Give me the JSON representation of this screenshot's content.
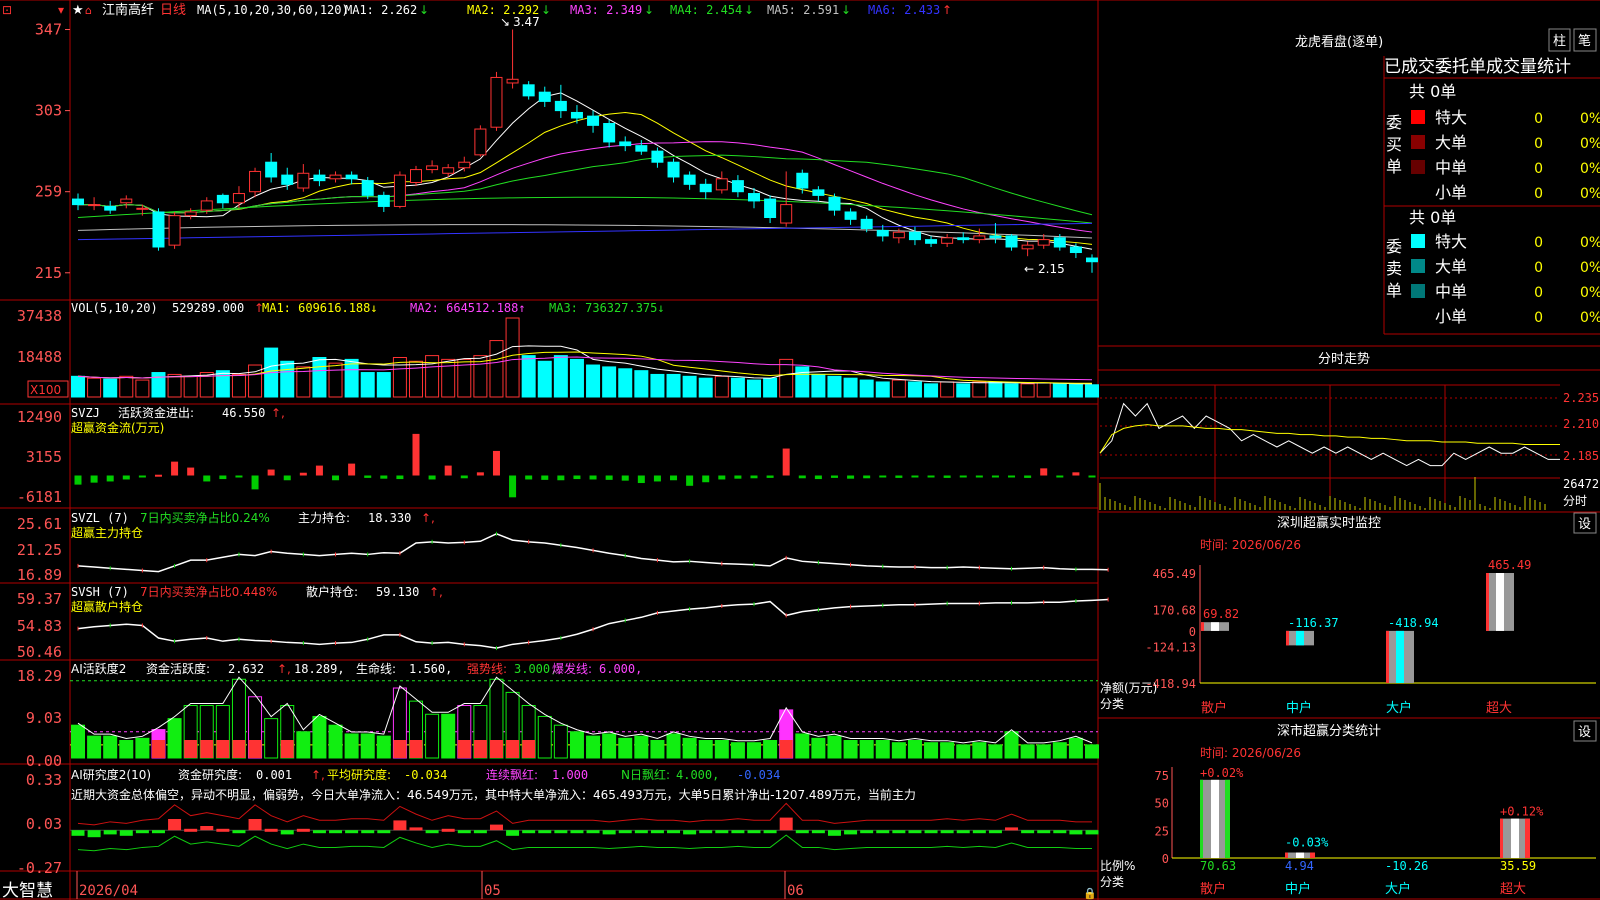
{
  "colors": {
    "up": "#ff3333",
    "down": "#00ffff",
    "grid": "#b00000",
    "ma1": "#ffffff",
    "ma2": "#ffff00",
    "ma3": "#ff44ff",
    "ma4": "#22dd22",
    "ma5": "#c0c0c0",
    "ma6": "#3333ff",
    "label": "#ff4444",
    "axis": "#ff5555"
  },
  "stock": {
    "name": "江南高纤",
    "period": "日线",
    "ma_label": "MA(5,10,20,30,60,120)"
  },
  "main_pane": {
    "ma_values": [
      {
        "name": "MA1",
        "value": "2.262",
        "arrow": "↓"
      },
      {
        "name": "MA2",
        "value": "2.292",
        "arrow": "↓"
      },
      {
        "name": "MA3",
        "value": "2.349",
        "arrow": "↓"
      },
      {
        "name": "MA4",
        "value": "2.454",
        "arrow": "↓"
      },
      {
        "name": "MA5",
        "value": "2.591",
        "arrow": "↓"
      },
      {
        "name": "MA6",
        "value": "2.433",
        "arrow": "↑"
      }
    ],
    "y_ticks": [
      "3.47",
      "3.03",
      "2.59",
      "2.15"
    ],
    "high_mark": "3.47",
    "low_mark": "2.15"
  },
  "vol_pane": {
    "title": "VOL(5,10,20)",
    "value": "529289.000",
    "ma1": "609616.188",
    "ma2": "664512.188",
    "ma3": "736327.375",
    "y_ticks": [
      "37438",
      "18488"
    ],
    "unit": "X100"
  },
  "svzj_pane": {
    "title": "SVZJ",
    "label": "活跃资金进出:",
    "value": "46.550",
    "sub": "超赢资金流(万元)",
    "y_ticks": [
      "12490",
      "3155",
      "-6181"
    ]
  },
  "svzl_pane": {
    "title": "SVZL (7)",
    "label1": "7日内买卖净占比0.24%",
    "label2": "主力持仓:",
    "value": "18.330",
    "sub": "超赢主力持仓",
    "y_ticks": [
      "25.61",
      "21.25",
      "16.89"
    ]
  },
  "svsh_pane": {
    "title": "SVSH (7)",
    "label1": "7日内买卖净占比0.448%",
    "label2": "散户持仓:",
    "value": "59.130",
    "sub": "超赢散户持仓",
    "y_ticks": [
      "59.37",
      "54.83",
      "50.46"
    ]
  },
  "ai_pane": {
    "title": "AI活跃度2",
    "l1": "资金活跃度:",
    "v1": "2.632",
    "v2": "18.289,",
    "l3": "生命线:",
    "v3": "1.560,",
    "l4": "强势线:",
    "v4": "3.000,",
    "l5": "爆发线:",
    "v5": "6.000,",
    "y_ticks": [
      "18.29",
      "9.03",
      "0.00"
    ]
  },
  "ai2_pane": {
    "title": "AI研究度2(10)",
    "l1": "资金研究度:",
    "v1": "0.001",
    "l2": "平均研究度:",
    "v2": "-0.034",
    "l3": "连续飘红:",
    "v3": "1.000",
    "l4": "N日飘红:",
    "v4": "4.000,",
    "v5": "-0.034",
    "desc": "近期大资金总体偏空，异动不明显，偏弱势，今日大单净流入：46.549万元，其中特大单净流入：465.493万元，大单5日累计净出-1207.489万元，当前主力",
    "y_ticks": [
      "0.33",
      "0.03",
      "-0.27"
    ]
  },
  "bottom": {
    "brand": "大智慧",
    "dates": [
      "2026/04",
      "05",
      "06"
    ]
  },
  "lhb": {
    "title": "龙虎看盘(逐单)",
    "btn1": "柱",
    "btn2": "笔",
    "header": "已成交委托单成交量统计",
    "buy_side": "委买单",
    "sell_side": "委卖单",
    "buy_total": "共 0单",
    "sell_total": "共 0单",
    "buy_rows": [
      {
        "label": "特大",
        "qty": "0",
        "pct": "0%"
      },
      {
        "label": "大单",
        "qty": "0",
        "pct": "0%"
      },
      {
        "label": "中单",
        "qty": "0",
        "pct": "0%"
      },
      {
        "label": "小单",
        "qty": "0",
        "pct": "0%"
      }
    ],
    "sell_rows": [
      {
        "label": "特大",
        "qty": "0",
        "pct": "0%"
      },
      {
        "label": "大单",
        "qty": "0",
        "pct": "0%"
      },
      {
        "label": "中单",
        "qty": "0",
        "pct": "0%"
      },
      {
        "label": "小单",
        "qty": "0",
        "pct": "0%"
      }
    ]
  },
  "intraday": {
    "title": "分时走势",
    "y_ticks": [
      "2.235",
      "2.210",
      "2.185"
    ],
    "vol_label": "26472",
    "tab": "分时"
  },
  "monitor": {
    "title": "深圳超赢实时监控",
    "btn": "设",
    "time": "时间: 2026/06/26",
    "y_ticks": [
      "465.49",
      "170.68",
      "0",
      "-124.13",
      "-418.94"
    ],
    "ylabel": "净额(万元)",
    "xlabel": "分类",
    "categories": [
      "散户",
      "中户",
      "大户",
      "超大"
    ]
  },
  "classify": {
    "title": "深市超赢分类统计",
    "btn": "设",
    "time": "时间: 2026/06/26",
    "y_ticks": [
      "75",
      "50",
      "25",
      "0"
    ],
    "ylabel": "比例%",
    "xlabel": "分类",
    "categories": [
      "散户",
      "中户",
      "大户",
      "超大"
    ]
  },
  "chart_data": [
    {
      "type": "candlestick",
      "title": "江南高纤 日线",
      "ma_periods": [
        5,
        10,
        20,
        30,
        60,
        120
      ],
      "ylim": [
        2.1,
        3.5
      ],
      "candles": [
        [
          2.55,
          2.52,
          2.58,
          2.49
        ],
        [
          2.52,
          2.52,
          2.56,
          2.49
        ],
        [
          2.51,
          2.49,
          2.54,
          2.47
        ],
        [
          2.53,
          2.55,
          2.57,
          2.5
        ],
        [
          2.5,
          2.5,
          2.52,
          2.46
        ],
        [
          2.48,
          2.29,
          2.5,
          2.27
        ],
        [
          2.3,
          2.46,
          2.48,
          2.28
        ],
        [
          2.46,
          2.48,
          2.5,
          2.44
        ],
        [
          2.49,
          2.54,
          2.56,
          2.47
        ],
        [
          2.57,
          2.53,
          2.58,
          2.5
        ],
        [
          2.53,
          2.58,
          2.62,
          2.5
        ],
        [
          2.59,
          2.7,
          2.72,
          2.56
        ],
        [
          2.75,
          2.67,
          2.8,
          2.64
        ],
        [
          2.68,
          2.63,
          2.72,
          2.6
        ],
        [
          2.61,
          2.69,
          2.74,
          2.59
        ],
        [
          2.68,
          2.65,
          2.71,
          2.62
        ],
        [
          2.66,
          2.68,
          2.7,
          2.64
        ],
        [
          2.68,
          2.66,
          2.7,
          2.63
        ],
        [
          2.65,
          2.57,
          2.67,
          2.55
        ],
        [
          2.57,
          2.51,
          2.59,
          2.48
        ],
        [
          2.51,
          2.68,
          2.7,
          2.5
        ],
        [
          2.64,
          2.71,
          2.73,
          2.62
        ],
        [
          2.71,
          2.73,
          2.76,
          2.69
        ],
        [
          2.69,
          2.72,
          2.74,
          2.67
        ],
        [
          2.72,
          2.75,
          2.78,
          2.7
        ],
        [
          2.79,
          2.93,
          2.95,
          2.78
        ],
        [
          2.94,
          3.21,
          3.24,
          2.92
        ],
        [
          3.18,
          3.2,
          3.47,
          3.15
        ],
        [
          3.17,
          3.11,
          3.19,
          3.09
        ],
        [
          3.13,
          3.08,
          3.16,
          3.05
        ],
        [
          3.08,
          3.03,
          3.17,
          2.99
        ],
        [
          3.02,
          2.99,
          3.06,
          2.96
        ],
        [
          3.0,
          2.95,
          3.03,
          2.91
        ],
        [
          2.96,
          2.86,
          2.98,
          2.83
        ],
        [
          2.86,
          2.84,
          2.89,
          2.81
        ],
        [
          2.84,
          2.81,
          2.87,
          2.79
        ],
        [
          2.81,
          2.75,
          2.83,
          2.72
        ],
        [
          2.75,
          2.67,
          2.77,
          2.64
        ],
        [
          2.68,
          2.63,
          2.7,
          2.6
        ],
        [
          2.63,
          2.59,
          2.66,
          2.55
        ],
        [
          2.6,
          2.66,
          2.7,
          2.58
        ],
        [
          2.65,
          2.59,
          2.68,
          2.56
        ],
        [
          2.58,
          2.54,
          2.61,
          2.5
        ],
        [
          2.55,
          2.45,
          2.57,
          2.42
        ],
        [
          2.42,
          2.52,
          2.7,
          2.4
        ],
        [
          2.69,
          2.61,
          2.71,
          2.58
        ],
        [
          2.6,
          2.57,
          2.62,
          2.54
        ],
        [
          2.56,
          2.49,
          2.58,
          2.46
        ],
        [
          2.48,
          2.44,
          2.5,
          2.41
        ],
        [
          2.44,
          2.39,
          2.46,
          2.37
        ],
        [
          2.38,
          2.35,
          2.41,
          2.32
        ],
        [
          2.34,
          2.37,
          2.39,
          2.31
        ],
        [
          2.37,
          2.33,
          2.4,
          2.3
        ],
        [
          2.33,
          2.31,
          2.35,
          2.29
        ],
        [
          2.31,
          2.34,
          2.36,
          2.29
        ],
        [
          2.34,
          2.33,
          2.37,
          2.31
        ],
        [
          2.33,
          2.35,
          2.39,
          2.31
        ],
        [
          2.35,
          2.34,
          2.42,
          2.31
        ],
        [
          2.35,
          2.29,
          2.36,
          2.27
        ],
        [
          2.28,
          2.3,
          2.32,
          2.24
        ],
        [
          2.3,
          2.33,
          2.36,
          2.28
        ],
        [
          2.34,
          2.29,
          2.36,
          2.27
        ],
        [
          2.29,
          2.26,
          2.31,
          2.23
        ],
        [
          2.23,
          2.21,
          2.25,
          2.15
        ]
      ],
      "ma_values": {
        "MA1": 2.262,
        "MA2": 2.292,
        "MA3": 2.349,
        "MA4": 2.454,
        "MA5": 2.591,
        "MA6": 2.433
      }
    },
    {
      "type": "bar",
      "title": "VOL(5,10,20)",
      "unit": "X100",
      "ylim": [
        0,
        42000
      ],
      "values": [
        11000,
        10000,
        9500,
        11000,
        9000,
        13000,
        12000,
        11000,
        13000,
        14000,
        12000,
        17000,
        26000,
        19000,
        16000,
        21000,
        18000,
        20000,
        13000,
        13000,
        21000,
        19000,
        22000,
        20000,
        20000,
        22000,
        30000,
        42000,
        22000,
        19000,
        22000,
        20000,
        17000,
        16000,
        15000,
        14000,
        12000,
        12000,
        11000,
        10000,
        11000,
        10000,
        9000,
        10000,
        20000,
        16000,
        12000,
        11000,
        10000,
        9000,
        8000,
        9000,
        8000,
        7000,
        8000,
        7000,
        8000,
        8000,
        7000,
        7000,
        7500,
        7000,
        6800,
        6500
      ]
    },
    {
      "type": "bar",
      "title": "SVZJ 超赢资金流(万元)",
      "ylim": [
        -6181,
        12490
      ],
      "values": [
        -2300,
        -1800,
        -1500,
        -1000,
        -500,
        200,
        3500,
        2000,
        -1500,
        -900,
        -400,
        -3500,
        1500,
        -1200,
        700,
        2500,
        -1200,
        3000,
        -600,
        -800,
        -900,
        10500,
        -1000,
        2500,
        -700,
        800,
        6200,
        -5500,
        -1000,
        -1100,
        -1200,
        -900,
        -1000,
        -1100,
        -1300,
        -1900,
        -1500,
        -1200,
        -2600,
        -1700,
        -1000,
        -800,
        -700,
        -600,
        6800,
        -700,
        -900,
        -600,
        -800,
        -700,
        -500,
        -600,
        -400,
        -500,
        -600,
        -500,
        -400,
        -500,
        -300,
        -600,
        1800,
        -500,
        800,
        -500,
        -800
      ]
    },
    {
      "type": "line",
      "title": "SVZL 超赢主力持仓",
      "ylim": [
        16.89,
        25.61
      ],
      "values": [
        19.0,
        18.8,
        18.6,
        18.4,
        18.2,
        18.0,
        19.0,
        20.0,
        20.0,
        20.5,
        21.0,
        20.8,
        21.5,
        21.2,
        21.0,
        20.8,
        21.0,
        21.2,
        21.0,
        21.3,
        21.2,
        23.0,
        23.2,
        23.0,
        23.1,
        23.3,
        24.6,
        23.5,
        23.2,
        23.0,
        22.6,
        22.2,
        21.7,
        21.2,
        20.8,
        20.3,
        20.0,
        19.7,
        19.8,
        19.6,
        19.4,
        19.3,
        19.2,
        19.0,
        20.4,
        19.8,
        19.6,
        19.4,
        19.2,
        19.0,
        18.9,
        18.8,
        18.8,
        18.7,
        18.7,
        18.8,
        18.7,
        18.6,
        18.5,
        18.6,
        18.7,
        18.5,
        18.4,
        18.4,
        18.33
      ]
    },
    {
      "type": "line",
      "title": "SVSH 超赢散户持仓",
      "ylim": [
        50.46,
        59.37
      ],
      "values": [
        54.5,
        54.8,
        55.0,
        55.2,
        55.0,
        53.0,
        52.5,
        52.8,
        53.0,
        52.5,
        52.8,
        52.6,
        52.5,
        52.3,
        52.2,
        52.0,
        52.2,
        52.3,
        52.8,
        53.5,
        53.5,
        52.4,
        52.2,
        52.3,
        52.0,
        51.8,
        51.4,
        52.0,
        52.3,
        52.6,
        53.0,
        53.6,
        54.4,
        55.3,
        55.8,
        56.3,
        57.0,
        57.3,
        57.6,
        57.8,
        58.1,
        58.3,
        58.4,
        58.8,
        56.6,
        57.2,
        57.5,
        57.8,
        58.0,
        58.1,
        58.2,
        58.3,
        58.3,
        58.4,
        58.5,
        58.5,
        58.5,
        58.6,
        58.6,
        58.6,
        58.7,
        58.7,
        58.9,
        59.0,
        59.13
      ]
    },
    {
      "type": "bar",
      "title": "AI活跃度2",
      "ylim": [
        0,
        18.29
      ],
      "reference_lines": [
        1.56,
        3.0,
        6.0
      ],
      "values": [
        7.5,
        5.0,
        5.0,
        4.0,
        4.5,
        6.5,
        9.0,
        12.0,
        12.0,
        12.0,
        18.0,
        14.0,
        9.0,
        12.0,
        6.0,
        9.5,
        7.5,
        5.5,
        5.5,
        5.0,
        16.0,
        13.0,
        10.0,
        10.0,
        12.0,
        12.0,
        18.0,
        15.0,
        12.0,
        9.5,
        7.5,
        6.0,
        5.0,
        5.5,
        4.5,
        5.0,
        4.0,
        5.5,
        4.5,
        4.0,
        4.0,
        3.5,
        3.5,
        4.0,
        11.0,
        5.5,
        4.5,
        5.0,
        4.0,
        4.0,
        4.0,
        3.5,
        4.0,
        3.5,
        3.5,
        3.0,
        3.5,
        3.0,
        6.0,
        3.0,
        3.0,
        3.5,
        4.5,
        3.0,
        2.6
      ]
    },
    {
      "type": "bar",
      "title": "AI研究度2(10)",
      "ylim": [
        -0.27,
        0.33
      ],
      "values": [
        -0.04,
        -0.05,
        -0.03,
        -0.04,
        -0.02,
        -0.01,
        0.08,
        0.01,
        0.03,
        0.01,
        -0.01,
        0.08,
        0.01,
        -0.03,
        0.01,
        -0.02,
        -0.02,
        -0.01,
        -0.01,
        -0.02,
        0.07,
        0.02,
        -0.02,
        0.01,
        -0.01,
        -0.01,
        0.04,
        -0.04,
        -0.02,
        -0.02,
        -0.02,
        -0.02,
        -0.02,
        -0.03,
        -0.02,
        -0.01,
        -0.02,
        -0.02,
        -0.03,
        -0.02,
        -0.02,
        -0.01,
        -0.02,
        -0.02,
        0.09,
        -0.02,
        -0.02,
        -0.04,
        -0.03,
        -0.02,
        -0.02,
        -0.02,
        -0.02,
        -0.02,
        -0.01,
        -0.02,
        -0.01,
        -0.02,
        0.02,
        -0.02,
        -0.02,
        -0.02,
        -0.03,
        -0.03,
        0.001
      ]
    },
    {
      "type": "line",
      "title": "分时走势",
      "ylim": [
        2.17,
        2.245
      ],
      "price": [
        2.19,
        2.2,
        2.23,
        2.22,
        2.23,
        2.21,
        2.215,
        2.22,
        2.21,
        2.22,
        2.215,
        2.21,
        2.2,
        2.205,
        2.2,
        2.195,
        2.2,
        2.195,
        2.19,
        2.195,
        2.19,
        2.195,
        2.19,
        2.185,
        2.19,
        2.185,
        2.18,
        2.185,
        2.18,
        2.18,
        2.19,
        2.185,
        2.19,
        2.195,
        2.19,
        2.19,
        2.195,
        2.19,
        2.185,
        2.185
      ],
      "avg": [
        2.19,
        2.205,
        2.21,
        2.212,
        2.213,
        2.212,
        2.212,
        2.212,
        2.211,
        2.21,
        2.21,
        2.209,
        2.209,
        2.208,
        2.207,
        2.206,
        2.206,
        2.205,
        2.205,
        2.204,
        2.204,
        2.203,
        2.203,
        2.202,
        2.202,
        2.201,
        2.2,
        2.2,
        2.2,
        2.199,
        2.199,
        2.199,
        2.198,
        2.198,
        2.198,
        2.198,
        2.197,
        2.197,
        2.197,
        2.197
      ]
    },
    {
      "type": "bar",
      "title": "深圳超赢实时监控",
      "categories": [
        "散户",
        "中户",
        "大户",
        "超大"
      ],
      "values": [
        69.82,
        -116.37,
        -418.94,
        465.49
      ],
      "ylim": [
        -418.94,
        465.49
      ]
    },
    {
      "type": "bar",
      "title": "深市超赢分类统计",
      "categories": [
        "散户",
        "中户",
        "大户",
        "超大"
      ],
      "values": [
        70.63,
        4.94,
        -10.26,
        35.59
      ],
      "change": [
        "+0.02%",
        "-0.03%",
        "",
        "+0.12%"
      ],
      "ylim": [
        0,
        75
      ]
    }
  ]
}
